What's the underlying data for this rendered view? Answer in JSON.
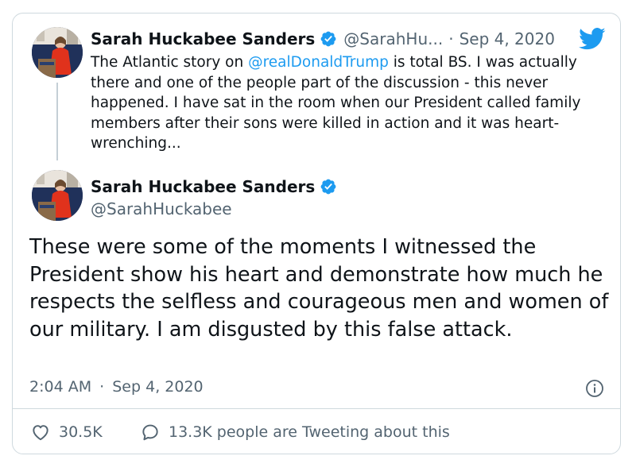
{
  "quoted_tweet": {
    "author_name": "Sarah Huckabee Sanders",
    "handle": "@SarahHu...",
    "separator": "·",
    "date": "Sep 4, 2020",
    "text_before_mention": "The Atlantic story on ",
    "mention": "@realDonaldTrump",
    "text_after_mention": " is total BS. I was actually there and one of the people part of the discussion - this never happened. I have sat in the room when our President called family members after their sons were killed in action and it was heart-wrenching..."
  },
  "main_tweet": {
    "author_name": "Sarah Huckabee Sanders",
    "handle": "@SarahHuckabee",
    "text": "These were some of the moments I witnessed the President show his heart and demonstrate how much he respects the selfless and courageous men and women of our military. I am disgusted by this false attack.",
    "time": "2:04 AM",
    "separator": "·",
    "date": "Sep 4, 2020"
  },
  "actions": {
    "likes": "30.5K",
    "replies_label": "13.3K people are Tweeting about this"
  },
  "icons": {
    "verified": "verified-badge-icon",
    "brand": "twitter-bird-icon",
    "info": "info-icon",
    "like": "heart-icon",
    "reply": "speech-bubble-icon"
  },
  "colors": {
    "accent": "#1d9bf0",
    "text": "#0f1419",
    "secondary": "#536471"
  }
}
